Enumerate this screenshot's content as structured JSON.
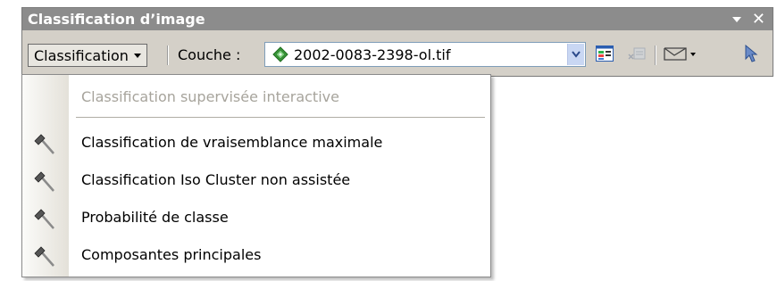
{
  "window": {
    "title": "Classification d’image"
  },
  "toolbar": {
    "menu_label": "Classification",
    "layer_label": "Couche :",
    "layer_value": "2002-0083-2398-ol.tif",
    "icons": [
      "layer-raster-icon",
      "dropdown-chevron-icon",
      "histogram-icon",
      "clear-training-icon",
      "draw-polygon-icon",
      "select-arrow-icon"
    ]
  },
  "menu": {
    "items": [
      {
        "label": "Classification supervisée interactive",
        "enabled": false,
        "icon": "none"
      },
      {
        "label": "Classification de vraisemblance maximale",
        "enabled": true,
        "icon": "hammer-icon"
      },
      {
        "label": "Classification Iso Cluster non assistée",
        "enabled": true,
        "icon": "hammer-icon"
      },
      {
        "label": "Probabilité de classe",
        "enabled": true,
        "icon": "hammer-icon"
      },
      {
        "label": "Composantes principales",
        "enabled": true,
        "icon": "hammer-icon"
      }
    ]
  }
}
